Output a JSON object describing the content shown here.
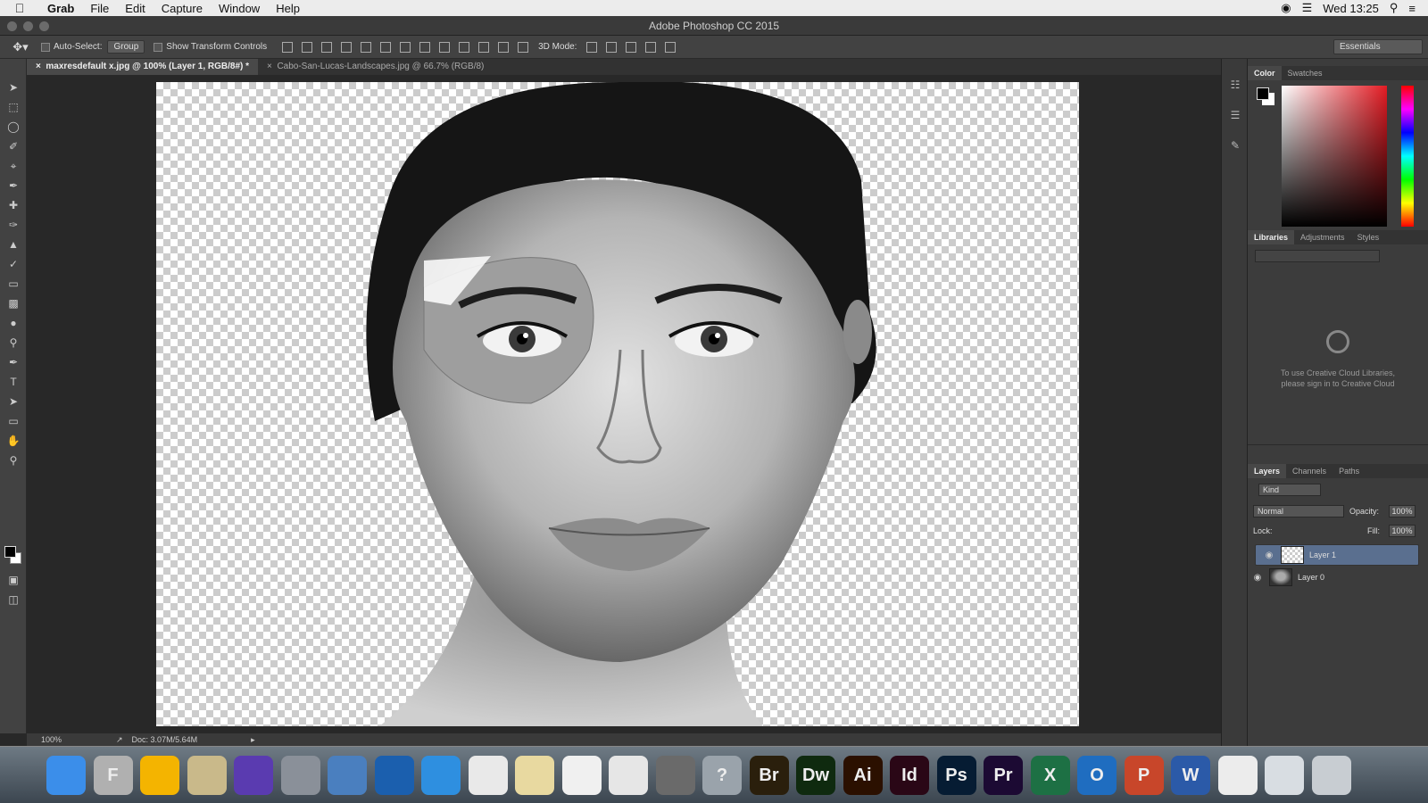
{
  "menubar": {
    "app": "Grab",
    "items": [
      "File",
      "Edit",
      "Capture",
      "Window",
      "Help"
    ],
    "clock": "Wed 13:25"
  },
  "window": {
    "title": "Adobe Photoshop CC 2015"
  },
  "options": {
    "auto_select_label": "Auto-Select:",
    "auto_select_value": "Group",
    "transform_label": "Show Transform Controls",
    "mode_3d_label": "3D Mode:",
    "workspace": "Essentials"
  },
  "tabs": [
    {
      "label": "maxresdefault x.jpg @ 100% (Layer 1, RGB/8#) *",
      "active": true
    },
    {
      "label": "Cabo-San-Lucas-Landscapes.jpg @ 66.7% (RGB/8)",
      "active": false
    }
  ],
  "status": {
    "zoom": "100%",
    "doc": "Doc: 3.07M/5.64M"
  },
  "color_panel": {
    "tabs": [
      "Color",
      "Swatches"
    ]
  },
  "libraries_panel": {
    "tabs": [
      "Libraries",
      "Adjustments",
      "Styles"
    ],
    "message_line1": "To use Creative Cloud Libraries,",
    "message_line2": "please sign in to Creative Cloud"
  },
  "layers_panel": {
    "tabs": [
      "Layers",
      "Channels",
      "Paths"
    ],
    "kind": "Kind",
    "blend_mode": "Normal",
    "opacity_label": "Opacity:",
    "opacity": "100%",
    "lock_label": "Lock:",
    "fill_label": "Fill:",
    "fill": "100%",
    "layers": [
      {
        "name": "Layer 1",
        "selected": true
      },
      {
        "name": "Layer 0",
        "selected": false
      }
    ]
  },
  "dock": {
    "apps": [
      {
        "label": "",
        "color": "#3b8eea"
      },
      {
        "label": "F",
        "color": "#b0b0b0"
      },
      {
        "label": "",
        "color": "#f4b400"
      },
      {
        "label": "",
        "color": "#c9b98a"
      },
      {
        "label": "",
        "color": "#5a3bb0"
      },
      {
        "label": "",
        "color": "#8a9099"
      },
      {
        "label": "",
        "color": "#4a7fbf"
      },
      {
        "label": "",
        "color": "#1b5fae"
      },
      {
        "label": "",
        "color": "#2e8fe0"
      },
      {
        "label": "",
        "color": "#e9e9e9"
      },
      {
        "label": "",
        "color": "#e8d9a0"
      },
      {
        "label": "",
        "color": "#f0f0f0"
      },
      {
        "label": "",
        "color": "#e6e6e6"
      },
      {
        "label": "",
        "color": "#6a6a6a"
      },
      {
        "label": "?",
        "color": "#9aa3ab"
      },
      {
        "label": "Br",
        "color": "#2a1f0c"
      },
      {
        "label": "Dw",
        "color": "#0f2a0f"
      },
      {
        "label": "Ai",
        "color": "#2b1000"
      },
      {
        "label": "Id",
        "color": "#2a0716"
      },
      {
        "label": "Ps",
        "color": "#061c33"
      },
      {
        "label": "Pr",
        "color": "#1c0a33"
      },
      {
        "label": "X",
        "color": "#1d7044"
      },
      {
        "label": "O",
        "color": "#1f6dc0"
      },
      {
        "label": "P",
        "color": "#c8462a"
      },
      {
        "label": "W",
        "color": "#2b5aa8"
      },
      {
        "label": "",
        "color": "#ececec"
      },
      {
        "label": "",
        "color": "#d8dde2"
      },
      {
        "label": "",
        "color": "#c8cdd2"
      }
    ]
  }
}
